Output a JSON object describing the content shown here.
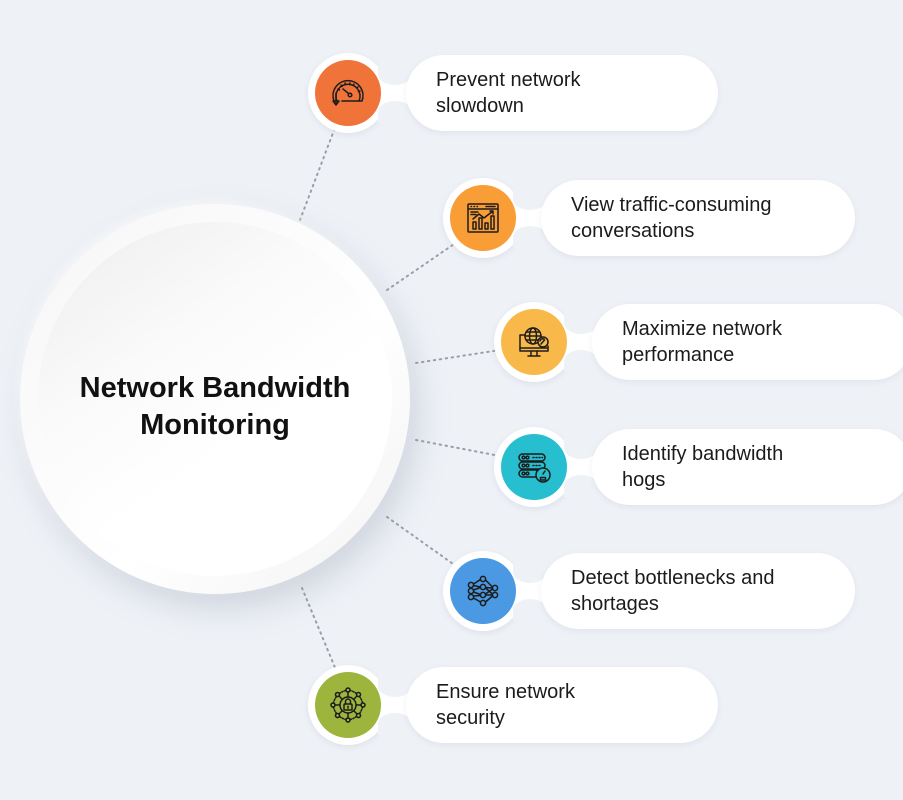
{
  "diagram": {
    "type": "radial-feature-map",
    "center": {
      "title_line1": "Network Bandwidth",
      "title_line2": "Monitoring"
    },
    "items": [
      {
        "label_line1": "Prevent network",
        "label_line2": "slowdown",
        "icon": "speedometer-down-icon",
        "color": "#f0743a"
      },
      {
        "label_line1": "View traffic-consuming",
        "label_line2": "conversations",
        "icon": "browser-chart-icon",
        "color": "#f99d37"
      },
      {
        "label_line1": "Maximize network",
        "label_line2": "performance",
        "icon": "monitor-globe-gauge-icon",
        "color": "#f8b94a"
      },
      {
        "label_line1": "Identify bandwidth",
        "label_line2": "hogs",
        "icon": "server-gauge-icon",
        "color": "#27bfcf"
      },
      {
        "label_line1": "Detect bottlenecks and",
        "label_line2": "shortages",
        "icon": "neural-network-icon",
        "color": "#4a99e2"
      },
      {
        "label_line1": "Ensure network",
        "label_line2": "security",
        "icon": "network-lock-icon",
        "color": "#9db43d"
      }
    ],
    "colors": {
      "background": "#eef1f6",
      "connector": "#9a9ea6",
      "label_text": "#1b1b1b",
      "title_text": "#111111"
    }
  }
}
